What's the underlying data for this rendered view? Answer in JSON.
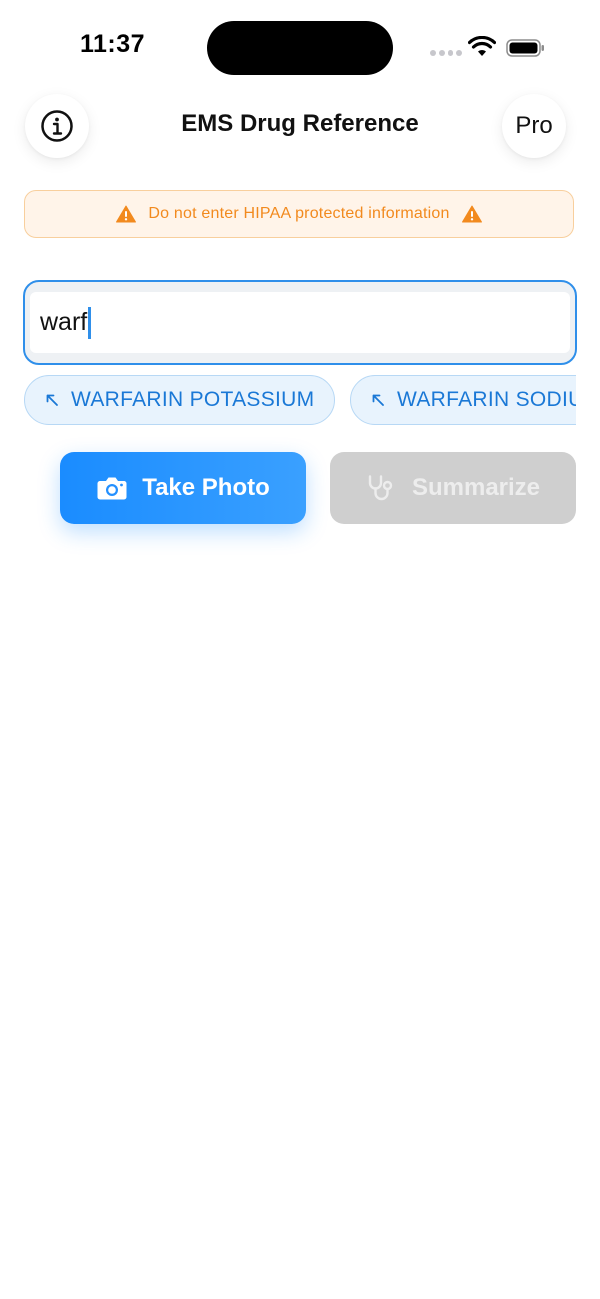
{
  "status_bar": {
    "time": "11:37"
  },
  "nav": {
    "title": "EMS Drug Reference",
    "pro_label": "Pro"
  },
  "banner": {
    "text": "Do not enter HIPAA protected information",
    "color": "#f28a1e"
  },
  "search": {
    "value": "warf"
  },
  "suggestions": [
    {
      "label": "WARFARIN POTASSIUM"
    },
    {
      "label": "WARFARIN SODIUM"
    }
  ],
  "actions": {
    "photo_label": "Take Photo",
    "summarize_label": "Summarize"
  },
  "colors": {
    "accent": "#1a8cff",
    "disabled": "#cfcfcf",
    "warning": "#f28a1e"
  }
}
